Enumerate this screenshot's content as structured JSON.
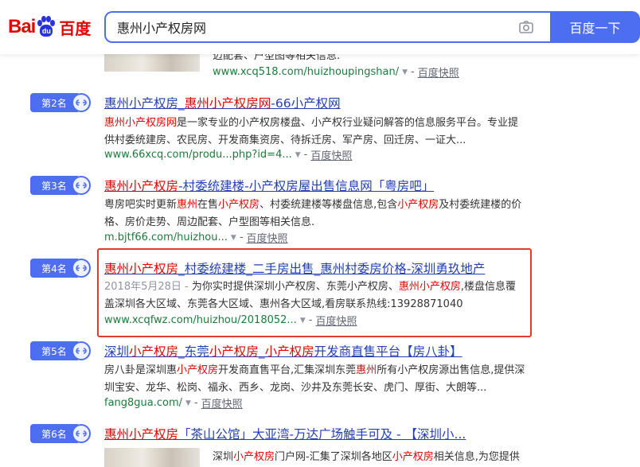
{
  "header": {
    "logo_bai": "Bai",
    "logo_du": "du",
    "logo_cn": "百度",
    "search_value": "惠州小产权房网",
    "search_button": "百度一下"
  },
  "results": [
    {
      "rank": "",
      "title_parts": [],
      "snippet_parts": [
        {
          "t": "迈配套、户型图等相关信息.",
          "em": false
        }
      ],
      "url": "www.xcq518.com/huizhoupingshan/",
      "cache": "百度快照"
    },
    {
      "rank": "第2名",
      "title_parts": [
        {
          "t": "惠州小产权房",
          "em": false
        },
        {
          "t": "_",
          "em": false
        },
        {
          "t": "惠州小产权房网",
          "em": true
        },
        {
          "t": "-66小产权网",
          "em": false
        }
      ],
      "snippet_parts": [
        {
          "t": "惠州小产权房网",
          "em": true
        },
        {
          "t": "是一家专业的小产权房楼盘、小产权行业疑问解答的信息服务平台。专业提供村委统建房、农民房、开发商集资房、待拆迁房、军产房、回迁房、一证大...",
          "em": false
        }
      ],
      "url": "www.66xcq.com/produ...php?id=4...",
      "cache": "百度快照"
    },
    {
      "rank": "第3名",
      "title_parts": [
        {
          "t": "惠州小产权房",
          "em": true
        },
        {
          "t": "-村委统建楼-小产权房屋出售信息网「粤房吧」",
          "em": false
        }
      ],
      "snippet_parts": [
        {
          "t": "粤房吧实时更新",
          "em": false
        },
        {
          "t": "惠州",
          "em": true
        },
        {
          "t": "在售",
          "em": false
        },
        {
          "t": "小产权房",
          "em": true
        },
        {
          "t": "、村委统建楼等楼盘信息,包含",
          "em": false
        },
        {
          "t": "小产权房",
          "em": true
        },
        {
          "t": "及村委统建楼的价格、房价走势、周边配套、户型图等相关信息.",
          "em": false
        }
      ],
      "url": "m.bjtf66.com/huizhou...",
      "cache": "百度快照"
    },
    {
      "rank": "第4名",
      "title_parts": [
        {
          "t": "惠州小产权房",
          "em": true
        },
        {
          "t": "_村委统建楼_二手房出售_惠州村委房价格-深圳勇玖地产",
          "em": false
        }
      ],
      "snippet_parts": [
        {
          "t": "2018年5月28日 - ",
          "em": false,
          "date": true
        },
        {
          "t": "为你实时提供深圳小产权房、东莞小产权房、",
          "em": false
        },
        {
          "t": "惠州小产权房",
          "em": true
        },
        {
          "t": ",楼盘信息覆盖深圳各大区域、东莞各大区域、惠州各大区域,看房联系热线:13928871040",
          "em": false
        }
      ],
      "url": "www.xcqfwz.com/huizhou/2018052...",
      "cache": "百度快照"
    },
    {
      "rank": "第5名",
      "title_parts": [
        {
          "t": "深圳",
          "em": false
        },
        {
          "t": "小产权房",
          "em": true
        },
        {
          "t": "_东莞",
          "em": false
        },
        {
          "t": "小产权房",
          "em": true
        },
        {
          "t": "_",
          "em": false
        },
        {
          "t": "小产权房",
          "em": true
        },
        {
          "t": "开发商直售平台【房八卦】",
          "em": false
        }
      ],
      "snippet_parts": [
        {
          "t": "房八卦是深圳惠",
          "em": false
        },
        {
          "t": "小产权房",
          "em": true
        },
        {
          "t": "开发商直售平台,汇集深圳东莞",
          "em": false
        },
        {
          "t": "惠州",
          "em": true
        },
        {
          "t": "所有小产权房源出售信息,提供深圳宝安、龙华、松岗、福永、西乡、龙岗、沙井及东莞长安、虎门、厚街、大朗等...",
          "em": false
        }
      ],
      "url": "fang8gua.com/",
      "cache": "百度快照"
    },
    {
      "rank": "第6名",
      "title_parts": [
        {
          "t": "惠州小产权房",
          "em": true
        },
        {
          "t": "「茶山公馆」大亚湾-万达广场触手可及 - 【深圳小...",
          "em": false
        }
      ],
      "snippet_parts": [
        {
          "t": "深圳",
          "em": false
        },
        {
          "t": "小产权房",
          "em": true
        },
        {
          "t": "门户网-汇集了深圳各地区",
          "em": false
        },
        {
          "t": "小产权房",
          "em": true
        },
        {
          "t": "相关信息,为您提供",
          "em": false
        }
      ],
      "url": "",
      "cache": ""
    }
  ]
}
